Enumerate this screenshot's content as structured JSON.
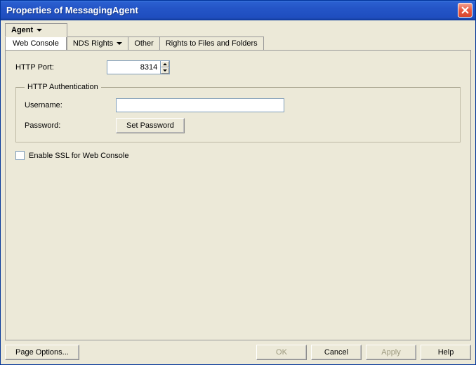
{
  "window": {
    "title": "Properties of MessagingAgent"
  },
  "tabs": {
    "agent": "Agent",
    "nds": "NDS Rights",
    "other": "Other",
    "rights": "Rights to Files and Folders",
    "subtab": "Web Console"
  },
  "form": {
    "http_port_label": "HTTP Port:",
    "http_port_value": "8314",
    "auth_group": "HTTP Authentication",
    "username_label": "Username:",
    "username_value": "",
    "password_label": "Password:",
    "set_password_btn": "Set Password",
    "enable_ssl_label": "Enable SSL for Web Console"
  },
  "footer": {
    "page_options": "Page Options...",
    "ok": "OK",
    "cancel": "Cancel",
    "apply": "Apply",
    "help": "Help"
  }
}
